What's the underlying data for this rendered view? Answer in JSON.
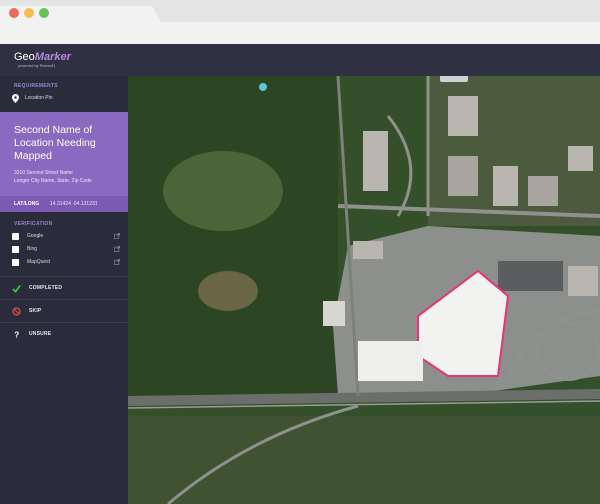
{
  "app": {
    "logo_geo": "Geo",
    "logo_marker": "Marker",
    "logo_sub": "powered by Rivers81"
  },
  "sidebar": {
    "requirements_label": "REQUIREMENTS",
    "requirement_item": "Location Pin",
    "location": {
      "title": "Second Name of Location Needing Mapped",
      "address_line1": "3210 Second Street Name",
      "address_line2": "Longer City Name, State, Zip Code",
      "latlong_label": "LAT/LONG",
      "latlong_value": "14.31424  -94.131231"
    },
    "verification_label": "VERIFICATION",
    "verification_sources": [
      {
        "label": "Google"
      },
      {
        "label": "Bing"
      },
      {
        "label": "MapQuest"
      }
    ],
    "actions": {
      "completed": "COMPLETED",
      "skip": "SKIP",
      "unsure": "UNSURE"
    }
  },
  "colors": {
    "accent": "#8a69c0",
    "sidebar_bg": "#2a2c3b",
    "appbar_bg": "#2f3142",
    "completed_green": "#3fbf4a",
    "skip_red": "#e0454b",
    "building_outline": "#e8327a"
  },
  "icons": {
    "pin": "map-pin-icon",
    "external": "external-link-icon",
    "completed": "check-icon",
    "skip": "no-entry-icon",
    "unsure": "question-icon"
  }
}
